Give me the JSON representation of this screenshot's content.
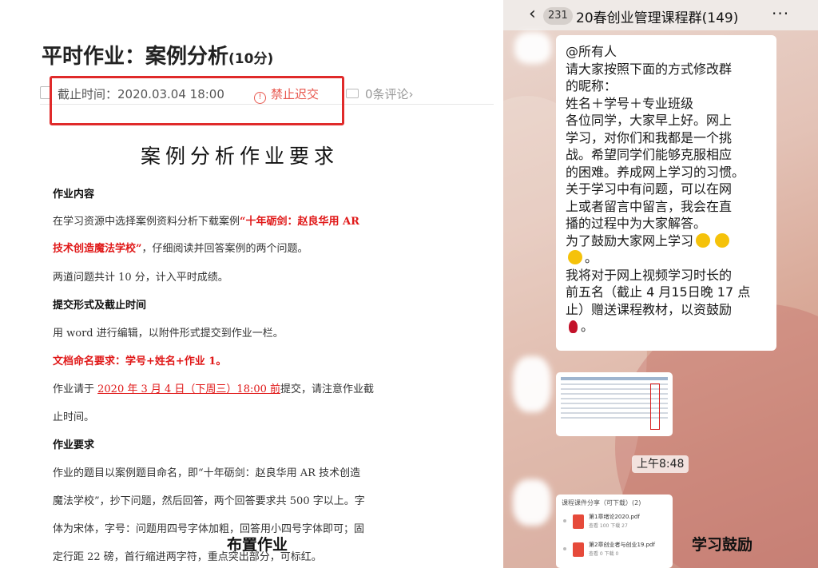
{
  "assignment": {
    "title": "平时作业：案例分析",
    "title_points": "(10分)",
    "deadline": "截止时间：2020.03.04 18:00",
    "no_late": "禁止迟交",
    "comments": "0条评论",
    "comments_arrow": "›"
  },
  "document": {
    "heading": "案例分析作业要求",
    "sec1_title": "作业内容",
    "p1_a": "在学习资源中选择案例资料分析下载案例",
    "p1_b": "“十年砺剑：赵良华用 AR",
    "p2_a": "技术创造魔法学校”",
    "p2_b": "，仔细阅读并回答案例的两个问题。",
    "p3": "两道问题共计 10 分，计入平时成绩。",
    "sec2_title": "提交形式及截止时间",
    "p4": "用 word 进行编辑，以附件形式提交到作业一栏。",
    "p5": "文档命名要求：学号+姓名+作业 1。",
    "p6_a": "作业请于 ",
    "p6_b": "2020 年 3 月 4 日（下周三）18:00 前",
    "p6_c": "提交，请注意作业截",
    "p7": "止时间。",
    "sec3_title": "作业要求",
    "p8": "作业的题目以案例题目命名，即“十年砺剑：赵良华用 AR 技术创造",
    "p9": "魔法学校”，抄下问题，然后回答，两个回答要求共 500 字以上。字",
    "p10": "体为宋体，字号：问题用四号字体加粗，回答用小四号字体即可；固",
    "p11": "定行距 22 磅，首行缩进两字符，重点突出部分，可标红。",
    "caption": "布置作业"
  },
  "chat": {
    "back": "‹",
    "unread": "231",
    "title": "20春创业管理课程群(149)",
    "more": "···",
    "message_lines": [
      "@所有人",
      "请大家按照下面的方式修改群",
      "的昵称：",
      "姓名＋学号＋专业班级",
      "各位同学，大家早上好。网上",
      "学习，对你们和我都是一个挑",
      "战。希望同学们能够克服相应",
      "的困难。养成网上学习的习惯。",
      "关于学习中有问题，可以在网",
      "上或者留言中留言，我会在直",
      "播的过程中为大家解答。",
      "为了鼓励大家网上学习"
    ],
    "line_after_emoji": "。",
    "line_rank_1": "我将对于网上视频学习时长的",
    "line_rank_2": "前五名（截止 4 月15日晚 17 点",
    "line_rank_3": "止）赠送课程教材，以资鼓励",
    "line_rose_end": "。",
    "time": "上午8:48",
    "file_card": {
      "header": "课程课件分享（可下载）(2)",
      "files": [
        {
          "name": "第1章绪论2020.pdf",
          "stats": "查看 100    下载 27"
        },
        {
          "name": "第2章创业者与创业19.pdf",
          "stats": "查看 0    下载 0"
        }
      ]
    },
    "caption": "学习鼓励"
  }
}
